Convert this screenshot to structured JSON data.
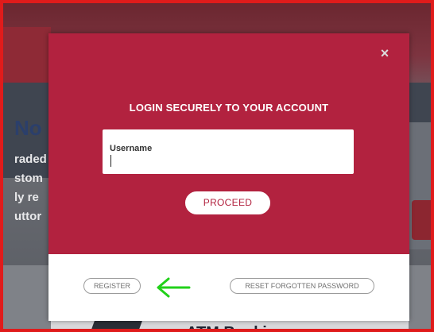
{
  "background": {
    "heading": "No",
    "lines": [
      "raded",
      "stom",
      "ly re",
      "uttor"
    ],
    "bottom_title": "ATM Banking"
  },
  "modal": {
    "close_symbol": "×",
    "title": "LOGIN SECURELY TO YOUR ACCOUNT",
    "username_label": "Username",
    "username_value": "",
    "proceed_label": "PROCEED",
    "register_label": "REGISTER",
    "reset_label": "RESET FORGOTTEN PASSWORD"
  },
  "annotation": {
    "arrow_icon": "left-arrow-icon",
    "arrow_color": "#22d11a"
  },
  "colors": {
    "accent": "#b2223f",
    "frame": "#e01b1b"
  }
}
